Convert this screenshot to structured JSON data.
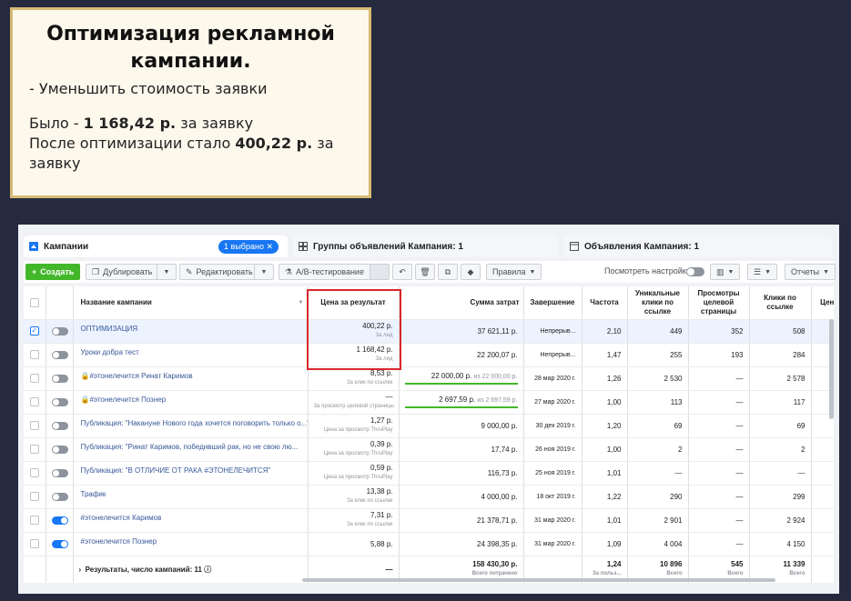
{
  "card": {
    "title": "Оптимизация рекламной кампании.",
    "line1": "- Уменьшить стоимость заявки",
    "was_prefix": "Было - ",
    "was_value": "1 168,42 р.",
    "was_suffix": " за заявку",
    "after_prefix": "После оптимизации стало ",
    "after_value": "400,22 р.",
    "after_suffix": " за заявку"
  },
  "tabs": {
    "campaigns": "Кампании",
    "selected_badge": "1 выбрано",
    "adsets": "Группы объявлений Кампания: 1",
    "ads": "Объявления Кампания: 1"
  },
  "toolbar": {
    "create": "Создать",
    "duplicate": "Дублировать",
    "edit": "Редактировать",
    "ab_test": "A/B-тестирование",
    "rules": "Правила",
    "view_settings": "Посмотреть настройки",
    "reports": "Отчеты"
  },
  "columns": {
    "name": "Название кампании",
    "cost": "Цена за результат",
    "spend": "Сумма затрат",
    "end": "Завершение",
    "freq": "Частота",
    "clicks_unique": "Уникальные клики по ссылке",
    "views": "Просмотры целевой страницы",
    "clicks": "Клики по ссылке",
    "price": "Цена"
  },
  "rows": [
    {
      "name": "ОПТИМИЗАЦИЯ",
      "cost": "400,22 р.",
      "cost_sub": "За лид",
      "spend": "37 621,11 р.",
      "end": "Непрерыв...",
      "freq": "2,10",
      "uc": "449",
      "views": "352",
      "clicks": "508"
    },
    {
      "name": "Уроки добра тест",
      "cost": "1 168,42 р.",
      "cost_sub": "За лид",
      "spend": "22 200,07 р.",
      "end": "Непрерыв...",
      "freq": "1,47",
      "uc": "255",
      "views": "193",
      "clicks": "284"
    },
    {
      "name": "#этонелечится Ринат Каримов",
      "cost": "8,53 р.",
      "cost_sub": "За клик по ссылке",
      "spend": "22 000,00 р.",
      "spend_of": "из 22 000,00 р.",
      "end": "28 мар 2020 г.",
      "freq": "1,26",
      "uc": "2 530",
      "views": "—",
      "clicks": "2 578"
    },
    {
      "name": "#этонелечится Познер",
      "cost": "—",
      "cost_sub": "За просмотр целевой страницы",
      "spend": "2 697,59 р.",
      "spend_of": "из 2 697,59 р.",
      "end": "27 мар 2020 г.",
      "freq": "1,00",
      "uc": "113",
      "views": "—",
      "clicks": "117"
    },
    {
      "name": "Публикация: \"Накануне Нового года хочется поговорить только о...\"",
      "cost": "1,27 р.",
      "cost_sub": "Цена за просмотр ThruPlay",
      "spend": "9 000,00 р.",
      "end": "30 дек 2019 г.",
      "freq": "1,20",
      "uc": "69",
      "views": "—",
      "clicks": "69"
    },
    {
      "name": "Публикация: \"Ринат Каримов, победивший рак, но не свою лю...",
      "cost": "0,39 р.",
      "cost_sub": "Цена за просмотр ThruPlay",
      "spend": "17,74 р.",
      "end": "26 ноя 2019 г.",
      "freq": "1,00",
      "uc": "2",
      "views": "—",
      "clicks": "2"
    },
    {
      "name": "Публикация: \"В ОТЛИЧИЕ ОТ РАКА #ЭТОНЕЛЕЧИТСЯ\"",
      "cost": "0,59 р.",
      "cost_sub": "Цена за просмотр ThruPlay",
      "spend": "116,73 р.",
      "end": "25 ноя 2019 г.",
      "freq": "1,01",
      "uc": "—",
      "views": "—",
      "clicks": "—"
    },
    {
      "name": "Трафик",
      "cost": "13,38 р.",
      "cost_sub": "За клик по ссылке",
      "spend": "4 000,00 р.",
      "end": "18 окт 2019 г.",
      "freq": "1,22",
      "uc": "290",
      "views": "—",
      "clicks": "299"
    },
    {
      "name": "#этонелечится Каримов",
      "cost": "7,31 р.",
      "cost_sub": "За клик по ссылке",
      "spend": "21 378,71 р.",
      "end": "31 мар 2020 г.",
      "freq": "1,01",
      "uc": "2 901",
      "views": "—",
      "clicks": "2 924"
    },
    {
      "name": "#этонелечится Познер",
      "cost": "5,88 р.",
      "cost_sub": "",
      "spend": "24 398,35 р.",
      "end": "31 мар 2020 г.",
      "freq": "1,09",
      "uc": "4 004",
      "views": "—",
      "clicks": "4 150"
    }
  ],
  "totals": {
    "label": "Результаты, число кампаний: 11",
    "cost": "—",
    "spend": "158 430,30 р.",
    "spend_sub": "Всего потрачено",
    "freq": "1,24",
    "freq_sub": "За польз...",
    "uc": "10 896",
    "uc_sub": "Всего",
    "views": "545",
    "views_sub": "Всего",
    "clicks": "11 339",
    "clicks_sub": "Всего"
  }
}
